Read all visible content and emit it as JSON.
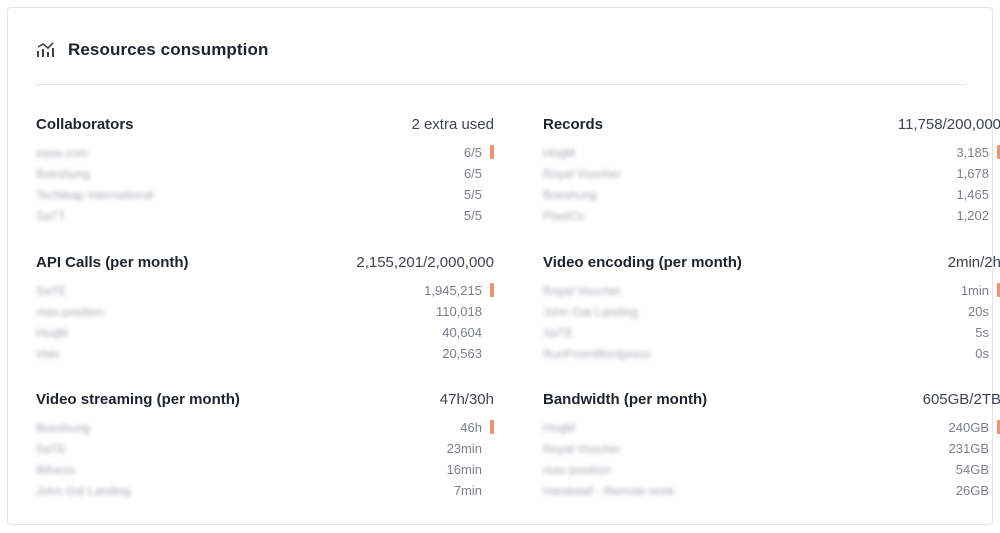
{
  "header": {
    "title": "Resources consumption",
    "icon": "chart-icon"
  },
  "colors": {
    "accent_bar": "#f0926a",
    "title_text": "#1f2330",
    "muted_text": "#7c7f8a",
    "divider": "#e4e4e7"
  },
  "sections": [
    {
      "title": "Collaborators",
      "total": "2 extra used",
      "rows": [
        {
          "name": "ease.com",
          "value": "6/5",
          "flag": true
        },
        {
          "name": "Boeshung",
          "value": "6/5",
          "flag": false
        },
        {
          "name": "Techleap International",
          "value": "5/5",
          "flag": false
        },
        {
          "name": "SaTT",
          "value": "5/5",
          "flag": false
        }
      ]
    },
    {
      "title": "Records",
      "total": "11,758/200,000",
      "rows": [
        {
          "name": "HoqM",
          "value": "3,185",
          "flag": true
        },
        {
          "name": "Royal Voucher",
          "value": "1,678",
          "flag": false
        },
        {
          "name": "Boeshung",
          "value": "1,465",
          "flag": false
        },
        {
          "name": "PixelCo",
          "value": "1,202",
          "flag": false
        }
      ]
    },
    {
      "title": "API Calls (per month)",
      "total": "2,155,201/2,000,000",
      "rows": [
        {
          "name": "SaTE",
          "value": "1,945,215",
          "flag": true
        },
        {
          "name": "max-position",
          "value": "110,018",
          "flag": false
        },
        {
          "name": "HoqM",
          "value": "40,604",
          "flag": false
        },
        {
          "name": "Velo",
          "value": "20,563",
          "flag": false
        }
      ]
    },
    {
      "title": "Video encoding (per month)",
      "total": "2min/2h",
      "rows": [
        {
          "name": "Royal Voucher",
          "value": "1min",
          "flag": true
        },
        {
          "name": "John Gat Landing",
          "value": "20s",
          "flag": false
        },
        {
          "name": "SaTE",
          "value": "5s",
          "flag": false
        },
        {
          "name": "RunFromWordpress",
          "value": "0s",
          "flag": false
        }
      ]
    },
    {
      "title": "Video streaming (per month)",
      "total": "47h/30h",
      "rows": [
        {
          "name": "Boeshung",
          "value": "46h",
          "flag": true
        },
        {
          "name": "SaTE",
          "value": "23min",
          "flag": false
        },
        {
          "name": "Bifness",
          "value": "16min",
          "flag": false
        },
        {
          "name": "John Gat Landing",
          "value": "7min",
          "flag": false
        }
      ]
    },
    {
      "title": "Bandwidth (per month)",
      "total": "605GB/2TB",
      "rows": [
        {
          "name": "HoqM",
          "value": "240GB",
          "flag": true
        },
        {
          "name": "Royal Voucher",
          "value": "231GB",
          "flag": false
        },
        {
          "name": "max-position",
          "value": "54GB",
          "flag": false
        },
        {
          "name": "Handstall - Remote work",
          "value": "26GB",
          "flag": false
        }
      ]
    }
  ]
}
